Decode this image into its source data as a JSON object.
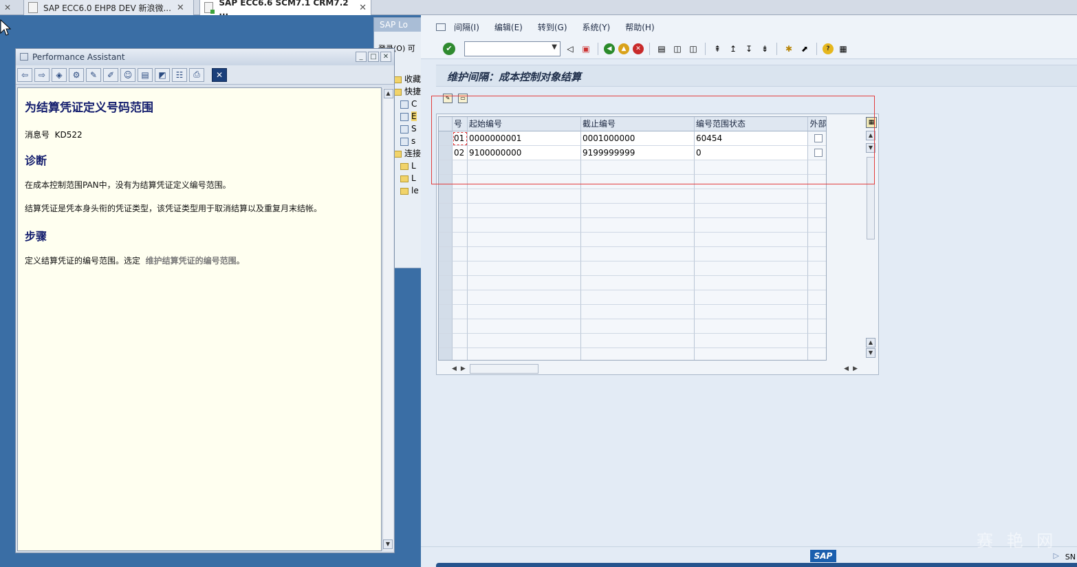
{
  "tabs": [
    {
      "label": "SAP ECC6.0 EHP8 DEV 新浪微..."
    },
    {
      "label": "SAP ECC6.6 SCM7.1 CRM7.2 ..."
    }
  ],
  "logon_window": {
    "title": "SAP Lo",
    "menu": "登录(O)  可",
    "tree": [
      {
        "label": "收藏",
        "type": "folder"
      },
      {
        "label": "快捷",
        "type": "folder"
      },
      {
        "label": "C",
        "type": "item"
      },
      {
        "label": "E",
        "type": "item"
      },
      {
        "label": "S",
        "type": "item"
      },
      {
        "label": "s",
        "type": "item"
      },
      {
        "label": "连接",
        "type": "folder"
      },
      {
        "label": "L",
        "type": "conn"
      },
      {
        "label": "L",
        "type": "conn"
      },
      {
        "label": "le",
        "type": "conn"
      }
    ]
  },
  "performance_assistant": {
    "title": "Performance Assistant",
    "heading": "为结算凭证定义号码范围",
    "message_label": "消息号",
    "message_number": "KD522",
    "diagnosis_title": "诊断",
    "diagnosis_p1": "在成本控制范围PAN中，没有为结算凭证定义编号范围。",
    "diagnosis_p2": "结算凭证是凭本身头衔的凭证类型，该凭证类型用于取消结算以及重复月末结帐。",
    "procedure_title": "步骤",
    "procedure_text": "定义结算凭证的编号范围。选定",
    "procedure_link": "维护结算凭证的编号范围",
    "procedure_end": "。"
  },
  "menu": {
    "items": [
      {
        "label": "间隔(I)"
      },
      {
        "label": "编辑(E)"
      },
      {
        "label": "转到(G)"
      },
      {
        "label": "系统(Y)"
      },
      {
        "label": "帮助(H)"
      }
    ]
  },
  "command_field": {
    "value": ""
  },
  "screen_title": "维护间隔：成本控制对象结算",
  "table": {
    "headers": [
      "号",
      "起始编号",
      "截止编号",
      "编号范围状态",
      "外部"
    ],
    "rows": [
      {
        "no": "01",
        "from": "0000000001",
        "to": "0001000000",
        "status": "60454",
        "external": false
      },
      {
        "no": "02",
        "from": "9100000000",
        "to": "9199999999",
        "status": "0",
        "external": false
      }
    ]
  },
  "statusbar": {
    "logo": "SAP",
    "system": "SN"
  },
  "watermark": "赛 艳 网"
}
